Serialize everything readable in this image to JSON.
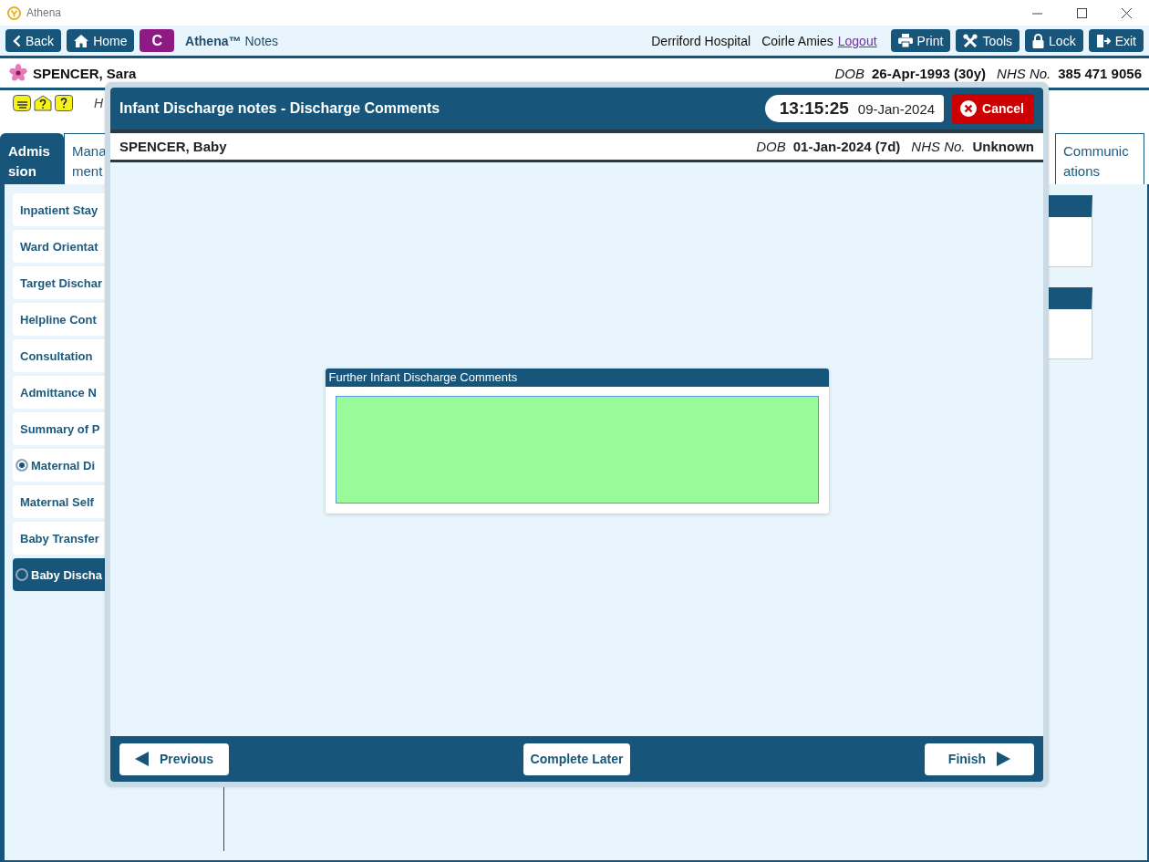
{
  "window": {
    "title": "Athena"
  },
  "toolbar": {
    "nav": [
      {
        "kind": "back",
        "label": "Back"
      },
      {
        "kind": "home",
        "label": "Home"
      },
      {
        "kind": "badge",
        "label": "C"
      }
    ],
    "brand": "Athena™",
    "app": "Notes",
    "location": "Derriford Hospital",
    "user": "Coirle Amies",
    "logout": "Logout",
    "actions": [
      {
        "kind": "print",
        "label": "Print"
      },
      {
        "kind": "tools",
        "label": "Tools"
      },
      {
        "kind": "lock",
        "label": "Lock"
      },
      {
        "kind": "exit",
        "label": "Exit"
      }
    ]
  },
  "patient": {
    "name": "SPENCER, Sara",
    "dob_label": "DOB",
    "dob": "26-Apr-1993 (30y)",
    "nhs_label": "NHS No.",
    "nhs": "385 471 9056"
  },
  "alerts": {
    "note": "H"
  },
  "tabs": [
    {
      "label": "Admission",
      "selected": true
    },
    {
      "label": "Mana ment",
      "selected": false
    },
    {
      "label": "Communications",
      "selected": false
    }
  ],
  "sidebar": {
    "items": [
      {
        "kind": "plain",
        "label": "Inpatient Stay",
        "selected": false
      },
      {
        "kind": "plain",
        "label": "Ward Orientat",
        "selected": false
      },
      {
        "kind": "plain",
        "label": "Target Dischar",
        "selected": false
      },
      {
        "kind": "plain",
        "label": "Helpline Cont",
        "selected": false
      },
      {
        "kind": "plain",
        "label": "Consultation",
        "selected": false
      },
      {
        "kind": "plain",
        "label": "Admittance N",
        "selected": false
      },
      {
        "kind": "plain",
        "label": "Summary of P",
        "selected": false
      },
      {
        "kind": "radio",
        "label": "Maternal Di",
        "checked": true,
        "selected": false
      },
      {
        "kind": "plain",
        "label": "Maternal Self",
        "selected": false
      },
      {
        "kind": "plain",
        "label": "Baby Transfer",
        "selected": false
      },
      {
        "kind": "radio",
        "label": "Baby Discha",
        "checked": false,
        "selected": true
      }
    ]
  },
  "dialog": {
    "title": "Infant Discharge notes - Discharge Comments",
    "time": "13:15:25",
    "date": "09-Jan-2024",
    "cancel": "Cancel",
    "patient": {
      "name": "SPENCER, Baby",
      "dob_label": "DOB",
      "dob": "01-Jan-2024 (7d)",
      "nhs_label": "NHS No.",
      "nhs": "Unknown"
    },
    "section": {
      "title": "Further Infant Discharge Comments"
    },
    "buttons": [
      {
        "kind": "previous",
        "label": "Previous"
      },
      {
        "kind": "later",
        "label": "Complete Later"
      },
      {
        "kind": "finish",
        "label": "Finish"
      }
    ]
  }
}
